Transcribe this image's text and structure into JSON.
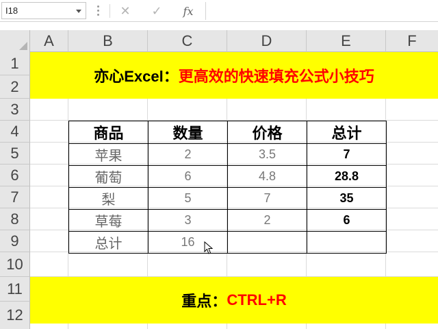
{
  "formula_bar": {
    "name_box": "I18",
    "fx_label": "fx",
    "formula": ""
  },
  "columns": [
    "A",
    "B",
    "C",
    "D",
    "E",
    "F"
  ],
  "rows": [
    "1",
    "2",
    "3",
    "4",
    "5",
    "6",
    "7",
    "8",
    "9",
    "10",
    "11",
    "12"
  ],
  "title_banner": {
    "prefix": "亦心Excel：",
    "title": "更高效的快速填充公式小技巧"
  },
  "table": {
    "headers": [
      "商品",
      "数量",
      "价格",
      "总计"
    ],
    "rows": [
      {
        "item": "苹果",
        "qty": "2",
        "price": "3.5",
        "total": "7"
      },
      {
        "item": "葡萄",
        "qty": "6",
        "price": "4.8",
        "total": "28.8"
      },
      {
        "item": "梨",
        "qty": "5",
        "price": "7",
        "total": "35"
      },
      {
        "item": "草莓",
        "qty": "3",
        "price": "2",
        "total": "6"
      }
    ],
    "summary": {
      "label": "总计",
      "qty": "16",
      "price": "",
      "total": ""
    }
  },
  "key_banner": {
    "prefix": "重点：",
    "shortcut": "CTRL+R"
  },
  "colors": {
    "banner_bg": "#ffff00",
    "accent_red": "#ff0000"
  }
}
